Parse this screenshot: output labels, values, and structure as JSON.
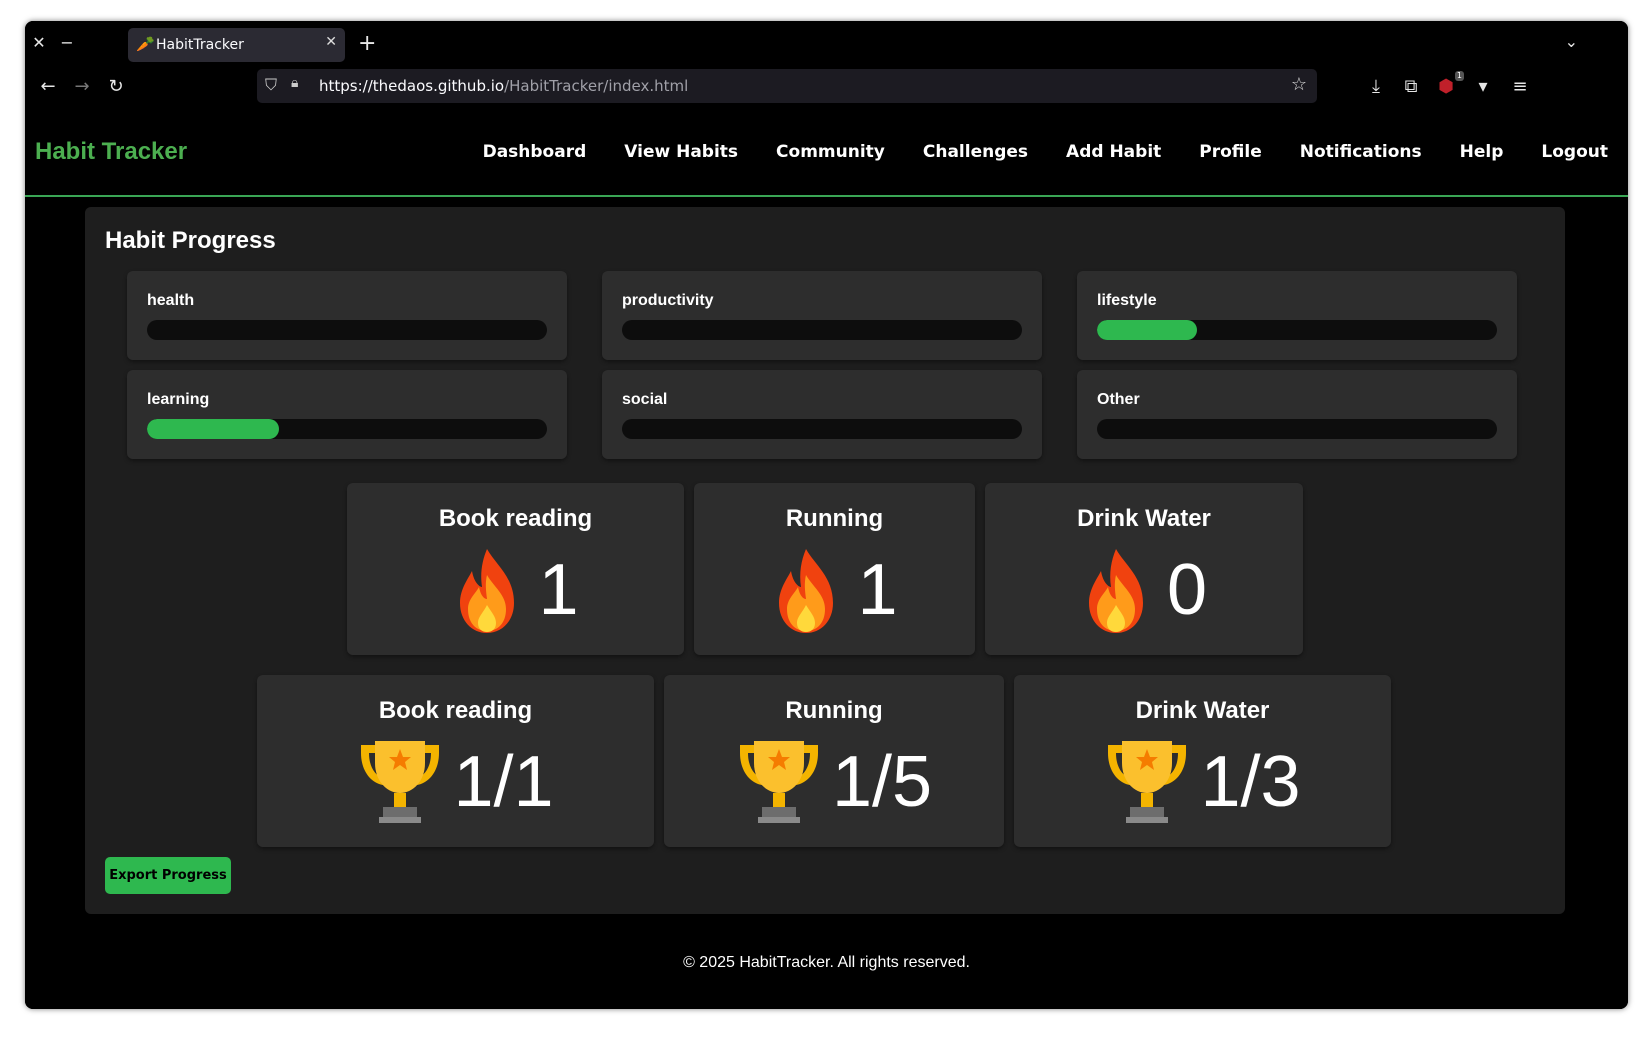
{
  "browser": {
    "tab_title": "HabitTracker",
    "tab_favicon": "🥕",
    "url_host": "https://thedaos.github.io",
    "url_path": "/HabitTracker/index.html",
    "extension_badge": "1"
  },
  "app": {
    "brand": "Habit Tracker",
    "nav": [
      "Dashboard",
      "View Habits",
      "Community",
      "Challenges",
      "Add Habit",
      "Profile",
      "Notifications",
      "Help",
      "Logout"
    ]
  },
  "progress": {
    "title": "Habit Progress",
    "categories": [
      {
        "label": "health",
        "fraction": 0
      },
      {
        "label": "productivity",
        "fraction": 0
      },
      {
        "label": "lifestyle",
        "fraction": 0.25
      },
      {
        "label": "learning",
        "fraction": 0.33
      },
      {
        "label": "social",
        "fraction": 0
      },
      {
        "label": "Other",
        "fraction": 0
      }
    ]
  },
  "streaks": [
    {
      "name": "Book reading",
      "value": "1",
      "icon": "fire-icon"
    },
    {
      "name": "Running",
      "value": "1",
      "icon": "fire-icon"
    },
    {
      "name": "Drink Water",
      "value": "0",
      "icon": "fire-icon"
    }
  ],
  "goals": [
    {
      "name": "Book reading",
      "value": "1/1",
      "icon": "trophy-icon"
    },
    {
      "name": "Running",
      "value": "1/5",
      "icon": "trophy-icon"
    },
    {
      "name": "Drink Water",
      "value": "1/3",
      "icon": "trophy-icon"
    }
  ],
  "export_label": "Export Progress",
  "footer": "© 2025 HabitTracker. All rights reserved.",
  "colors": {
    "accent": "#4caf50",
    "bar_fill": "#2eb84f"
  }
}
